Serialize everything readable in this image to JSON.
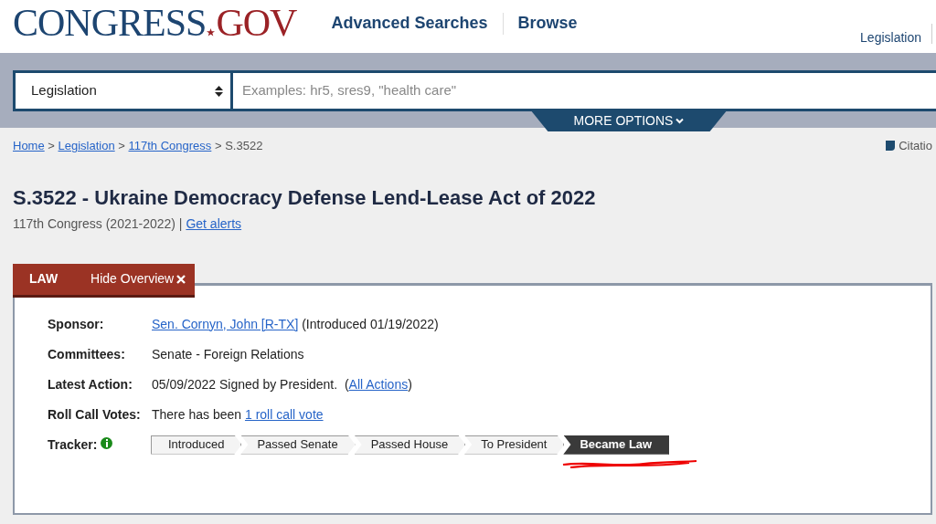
{
  "logo": {
    "left": "CONGRESS",
    "right": "GOV"
  },
  "nav": [
    "Advanced Searches",
    "Browse"
  ],
  "top_link": "Legislation",
  "search": {
    "scope": "Legislation",
    "placeholder": "Examples: hr5, sres9, \"health care\"",
    "more_options": "MORE OPTIONS"
  },
  "breadcrumbs": {
    "separator": ">",
    "items": [
      {
        "text": "Home",
        "link": true
      },
      {
        "text": "Legislation",
        "link": true
      },
      {
        "text": "117th Congress",
        "link": true
      },
      {
        "text": "S.3522",
        "link": false
      }
    ]
  },
  "citation": "Citatio",
  "title": "S.3522 - Ukraine Democracy Defense Lend-Lease Act of 2022",
  "subtitle": {
    "text": "117th Congress (2021-2022) | ",
    "link": "Get alerts"
  },
  "tabs": [
    {
      "label": "LAW",
      "kind": "status"
    },
    {
      "label": "Hide Overview",
      "kind": "toggle"
    }
  ],
  "overview": [
    {
      "label": "Sponsor:",
      "parts": [
        {
          "text": "Sen. Cornyn, John [R-TX]",
          "link": true
        },
        {
          "text": " (Introduced 01/19/2022)",
          "link": false
        }
      ]
    },
    {
      "label": "Committees:",
      "parts": [
        {
          "text": "Senate - Foreign Relations",
          "link": false
        }
      ]
    },
    {
      "label": "Latest Action:",
      "parts": [
        {
          "text": "05/09/2022 Signed by President.  (",
          "link": false
        },
        {
          "text": "All Actions",
          "link": true
        },
        {
          "text": ")",
          "link": false
        }
      ]
    },
    {
      "label": "Roll Call Votes:",
      "parts": [
        {
          "text": "There has been ",
          "link": false
        },
        {
          "text": "1 roll call vote",
          "link": true
        }
      ]
    }
  ],
  "tracker": {
    "label": "Tracker:",
    "steps": [
      {
        "label": "Introduced",
        "selected": false
      },
      {
        "label": "Passed Senate",
        "selected": false
      },
      {
        "label": "Passed House",
        "selected": false
      },
      {
        "label": "To President",
        "selected": false
      },
      {
        "label": "Became Law",
        "selected": true
      }
    ]
  }
}
